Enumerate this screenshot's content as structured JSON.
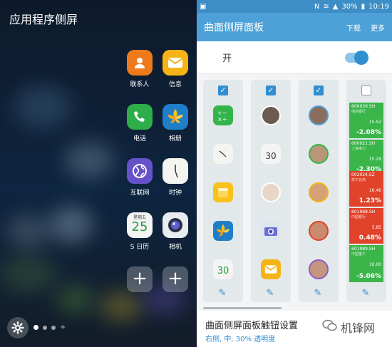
{
  "left_panel": {
    "title": "应用程序侧屏",
    "apps": [
      {
        "label": "联系人",
        "icon": "contacts-icon",
        "color": "#ee7a1c"
      },
      {
        "label": "信息",
        "icon": "messages-icon",
        "color": "#f5b315"
      },
      {
        "label": "电话",
        "icon": "phone-icon",
        "color": "#2dae48"
      },
      {
        "label": "相册",
        "icon": "gallery-icon",
        "color": "#f2b61d"
      },
      {
        "label": "互联网",
        "icon": "internet-icon",
        "color": "#6652c8"
      },
      {
        "label": "时钟",
        "icon": "clock-icon",
        "color": "#f4f4f0"
      },
      {
        "label": "S 日历",
        "icon": "calendar-icon",
        "color": "#f4f4f4",
        "calendar_weekday": "星期五",
        "calendar_day": "25"
      },
      {
        "label": "相机",
        "icon": "camera-icon",
        "color": "#e9edf2"
      }
    ],
    "add_label": "+",
    "page_plus": "+"
  },
  "status_bar": {
    "battery": "30%",
    "time": "10:19"
  },
  "app_bar": {
    "title": "曲面侧屏面板",
    "download": "下载",
    "more": "更多"
  },
  "toggle": {
    "label": "开",
    "on": true
  },
  "panels": [
    {
      "checked": true,
      "name": "tools-panel"
    },
    {
      "checked": true,
      "name": "people-panel"
    },
    {
      "checked": true,
      "name": "contacts-panel"
    },
    {
      "checked": false,
      "name": "stocks-panel"
    }
  ],
  "check_mark": "✓",
  "stocks": [
    {
      "code": "600036.SH",
      "name": "招商银行",
      "price": "15.52",
      "change": "-2.08%",
      "color": "#3ab54a"
    },
    {
      "code": "600021.SH",
      "name": "上海电力",
      "price": "15.29",
      "change": "-2.30%",
      "color": "#3ab54a"
    },
    {
      "code": "002024.SZ",
      "name": "苏宁云商",
      "price": "16.46",
      "change": "1.23%",
      "color": "#e0432a"
    },
    {
      "code": "601988.SH",
      "name": "中国银行",
      "price": "3.85",
      "change": "0.48%",
      "color": "#e0432a"
    },
    {
      "code": "601989.SH",
      "name": "中国重工",
      "price": "10.00",
      "change": "-5.06%",
      "color": "#3ab54a"
    }
  ],
  "tool_day": "30",
  "bottom": {
    "title": "曲面侧屏面板触钮设置",
    "subtitle": "右侧, 中, 30% 透明度"
  },
  "watermark": "机锋网"
}
